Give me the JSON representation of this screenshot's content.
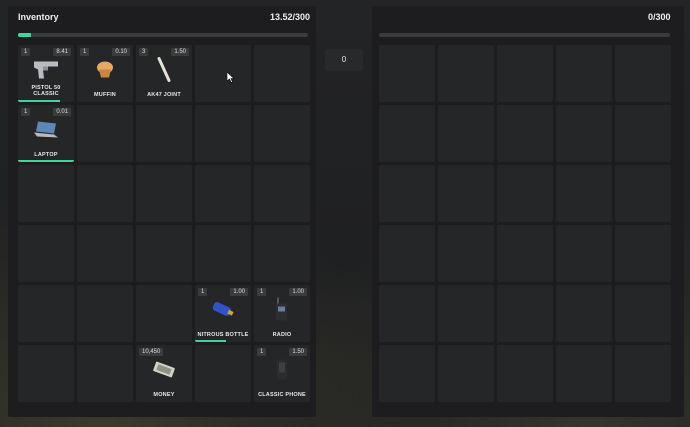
{
  "player": {
    "title": "Inventory",
    "weight": "13.52/300",
    "weight_fraction": 0.045
  },
  "amount_input": {
    "value": "0"
  },
  "secondary": {
    "weight": "0/300",
    "weight_fraction": 0
  },
  "items": {
    "pistol": {
      "count": "1",
      "weight": "8.41",
      "name": "PISTOL 50 CLASSIC",
      "icon": "pistol-icon",
      "durability": 0.75
    },
    "muffin": {
      "count": "1",
      "weight": "0.10",
      "name": "MUFFIN",
      "icon": "muffin-icon"
    },
    "joint": {
      "count": "3",
      "weight": "1.50",
      "name": "AK47 JOINT",
      "icon": "joint-icon"
    },
    "laptop": {
      "count": "1",
      "weight": "0.01",
      "name": "LAPTOP",
      "icon": "laptop-icon",
      "durability": 1.0
    },
    "nitrous": {
      "count": "1",
      "weight": "1.00",
      "name": "NITROUS BOTTLE",
      "icon": "nitrous-bottle-icon",
      "durability": 0.55
    },
    "radio": {
      "count": "1",
      "weight": "1.00",
      "name": "RADIO",
      "icon": "radio-icon"
    },
    "money": {
      "count": "10,450",
      "name": "MONEY",
      "icon": "cash-icon"
    },
    "phone": {
      "count": "1",
      "weight": "1.50",
      "name": "CLASSIC PHONE",
      "icon": "phone-icon"
    }
  },
  "colors": {
    "accent": "#3fd69b",
    "slot": "#252628",
    "panel": "#1d1d1f"
  }
}
